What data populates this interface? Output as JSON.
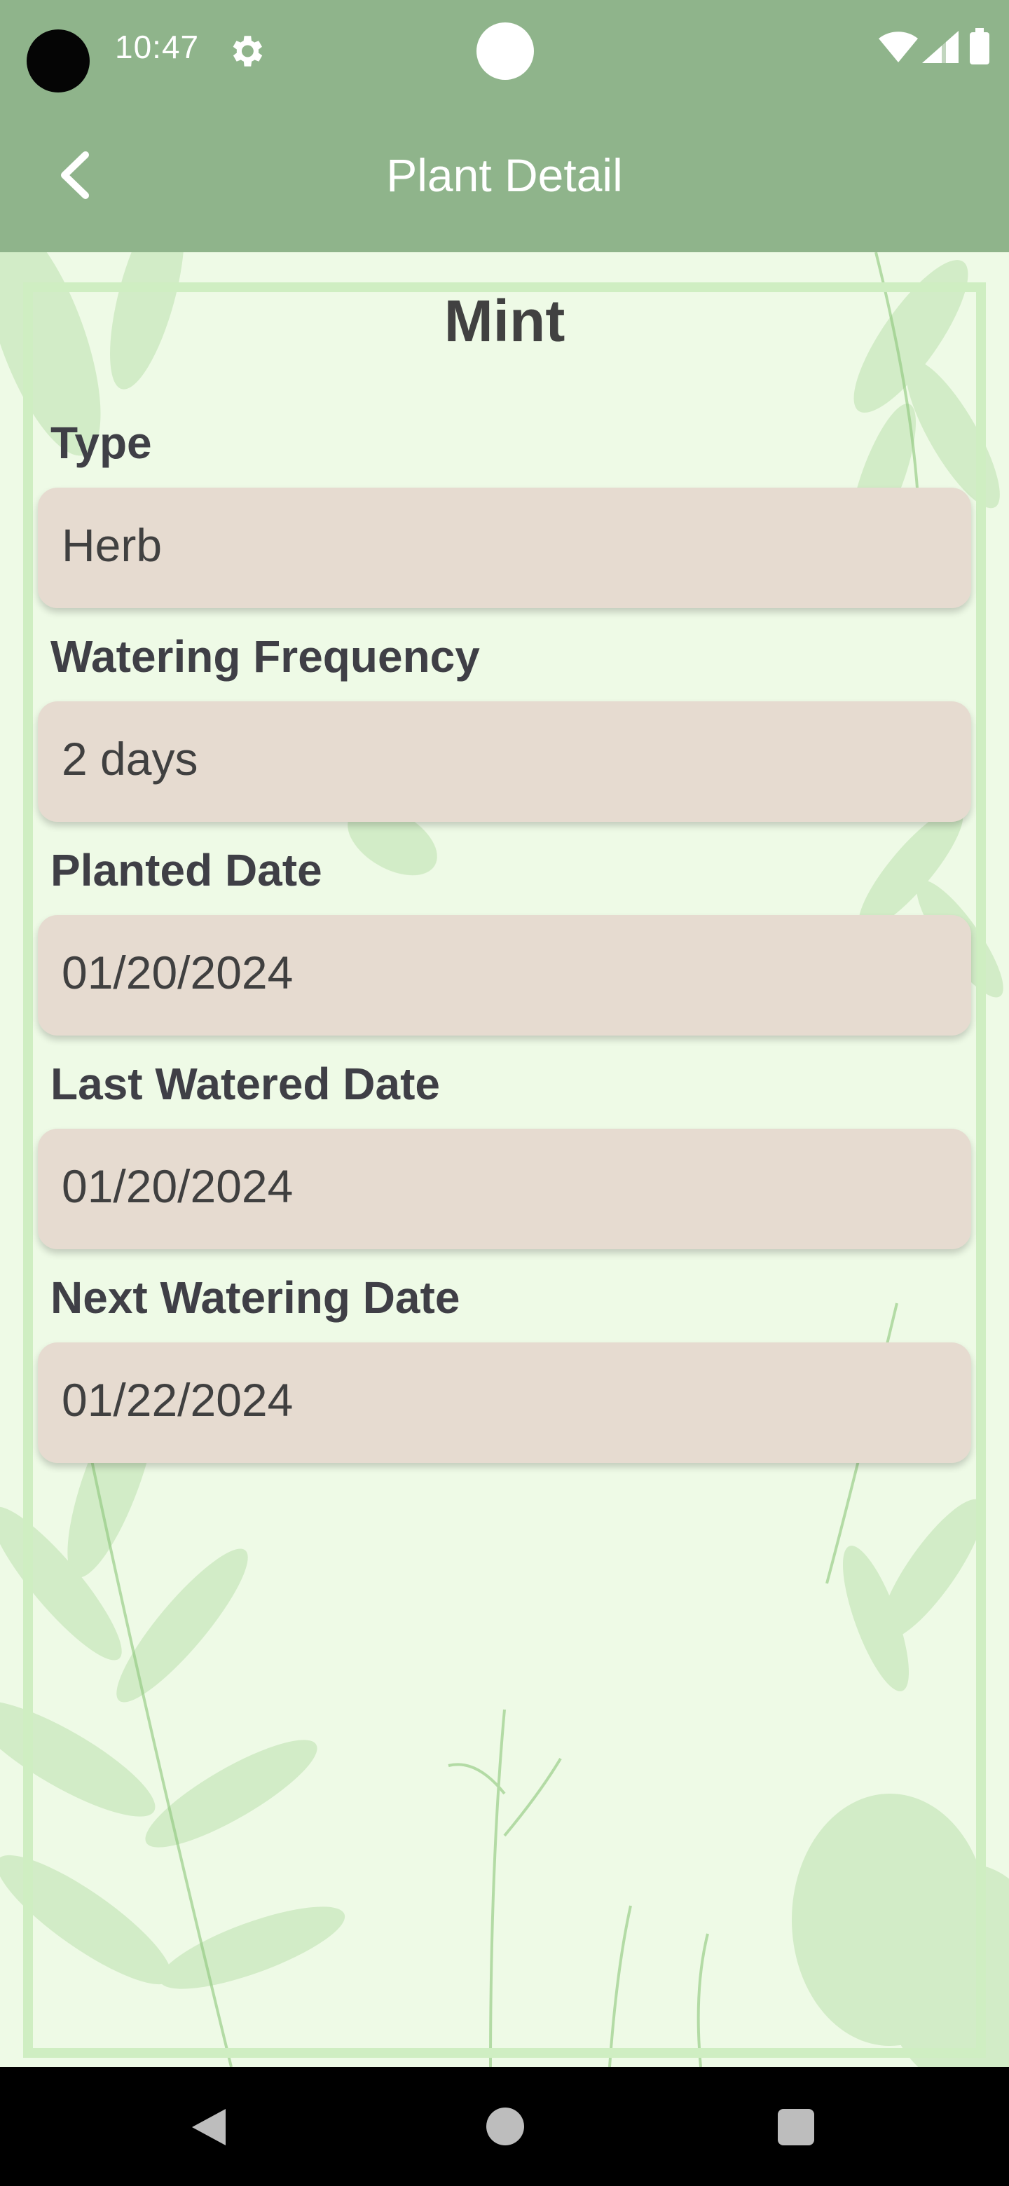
{
  "status_bar": {
    "time": "10:47",
    "icons": [
      "gear-icon",
      "wifi-icon",
      "signal-icon",
      "battery-icon"
    ]
  },
  "app_bar": {
    "title": "Plant Detail",
    "back_icon": "chevron-left-icon",
    "background_color": "#8fb48b"
  },
  "plant": {
    "name": "Mint",
    "fields": [
      {
        "label": "Type",
        "value": "Herb"
      },
      {
        "label": "Watering Frequency",
        "value": "2 days"
      },
      {
        "label": "Planted Date",
        "value": "01/20/2024"
      },
      {
        "label": "Last Watered Date",
        "value": "01/20/2024"
      },
      {
        "label": "Next Watering Date",
        "value": "01/22/2024"
      }
    ]
  },
  "colors": {
    "content_background": "#eefae6",
    "field_background": "#e6dbd0",
    "text": "#3f3f46"
  },
  "nav_bar": {
    "icons": [
      "back-triangle-icon",
      "home-circle-icon",
      "recents-square-icon"
    ]
  }
}
